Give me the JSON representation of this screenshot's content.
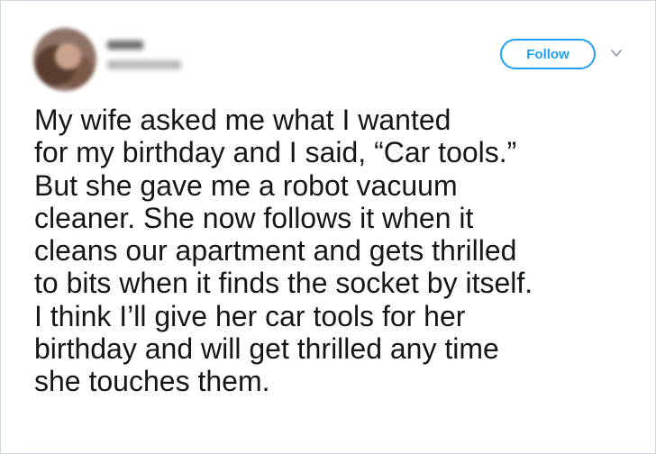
{
  "header": {
    "follow_label": "Follow"
  },
  "icons": {
    "avatar": "avatar-blurred",
    "more": "chevron-down-icon"
  },
  "colors": {
    "accent": "#1da1f2",
    "text": "#14171a",
    "border": "#cfd9de"
  },
  "tweet": {
    "text": "My wife asked me what I wanted\nfor my birthday and I said, “Car tools.”\nBut she gave me a robot vacuum\ncleaner. She now follows it when it\ncleans our apartment and gets thrilled\nto bits when it finds the socket by itself.\nI think I’ll give her car tools for her\nbirthday and will get thrilled any time\nshe touches them."
  }
}
